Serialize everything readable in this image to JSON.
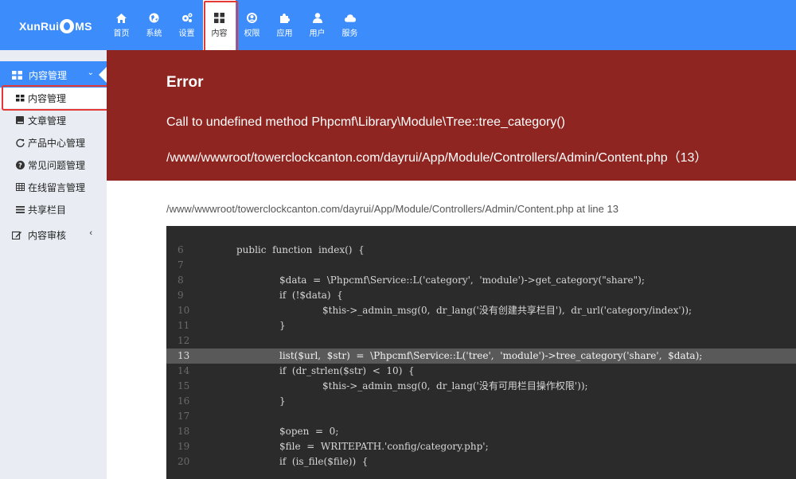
{
  "logo": {
    "text_left": "XunRui",
    "text_right": "MS"
  },
  "nav": {
    "items": [
      {
        "label": "首页",
        "icon": "home-icon"
      },
      {
        "label": "系统",
        "icon": "globe-icon"
      },
      {
        "label": "设置",
        "icon": "cogs-icon"
      },
      {
        "label": "内容",
        "icon": "th-large-icon"
      },
      {
        "label": "权限",
        "icon": "user-circle-icon"
      },
      {
        "label": "应用",
        "icon": "puzzle-icon"
      },
      {
        "label": "用户",
        "icon": "user-icon"
      },
      {
        "label": "服务",
        "icon": "cloud-icon"
      }
    ],
    "active_index": 3
  },
  "sidebar": {
    "group1": {
      "label": "内容管理",
      "chevron": "⌄"
    },
    "items": [
      {
        "label": "内容管理",
        "icon": "th-large-icon"
      },
      {
        "label": "文章管理",
        "icon": "book-icon"
      },
      {
        "label": "产品中心管理",
        "icon": "refresh-icon"
      },
      {
        "label": "常见问题管理",
        "icon": "question-icon"
      },
      {
        "label": "在线留言管理",
        "icon": "table-icon"
      },
      {
        "label": "共享栏目",
        "icon": "bars-icon"
      }
    ],
    "group2": {
      "label": "内容审核",
      "chevron": "‹"
    }
  },
  "error": {
    "title": "Error",
    "message": "Call to undefined method Phpcmf\\Library\\Module\\Tree::tree_category()",
    "file": "/www/wwwroot/towerclockcanton.com/dayrui/App/Module/Controllers/Admin/Content.php（13）"
  },
  "location": "/www/wwwroot/towerclockcanton.com/dayrui/App/Module/Controllers/Admin/Content.php at line 13",
  "code": {
    "highlight_line": "13",
    "lines": [
      {
        "n": "6",
        "indent": 1,
        "text": "public  function  index()  {"
      },
      {
        "n": "7",
        "indent": 0,
        "text": ""
      },
      {
        "n": "8",
        "indent": 2,
        "text": "$data  =  \\Phpcmf\\Service::L('category',  'module')->get_category(\"share\");"
      },
      {
        "n": "9",
        "indent": 2,
        "text": "if  (!$data)  {"
      },
      {
        "n": "10",
        "indent": 3,
        "text": "$this->_admin_msg(0,  dr_lang('没有创建共享栏目'),  dr_url('category/index'));"
      },
      {
        "n": "11",
        "indent": 2,
        "text": "}"
      },
      {
        "n": "12",
        "indent": 0,
        "text": ""
      },
      {
        "n": "13",
        "indent": 2,
        "text": "list($url,  $str)  =  \\Phpcmf\\Service::L('tree',  'module')->tree_category('share',  $data);"
      },
      {
        "n": "14",
        "indent": 2,
        "text": "if  (dr_strlen($str)  <  10)  {"
      },
      {
        "n": "15",
        "indent": 3,
        "text": "$this->_admin_msg(0,  dr_lang('没有可用栏目操作权限'));"
      },
      {
        "n": "16",
        "indent": 2,
        "text": "}"
      },
      {
        "n": "17",
        "indent": 0,
        "text": ""
      },
      {
        "n": "18",
        "indent": 2,
        "text": "$open  =  0;"
      },
      {
        "n": "19",
        "indent": 2,
        "text": "$file  =  WRITEPATH.'config/category.php';"
      },
      {
        "n": "20",
        "indent": 2,
        "text": "if  (is_file($file))  {"
      }
    ]
  },
  "colors": {
    "topbar": "#3c8dfb",
    "error_bg": "#8e2520",
    "sidebar_bg": "#e9edf3",
    "code_bg": "#2b2b2b",
    "highlight_border": "#e53935"
  }
}
